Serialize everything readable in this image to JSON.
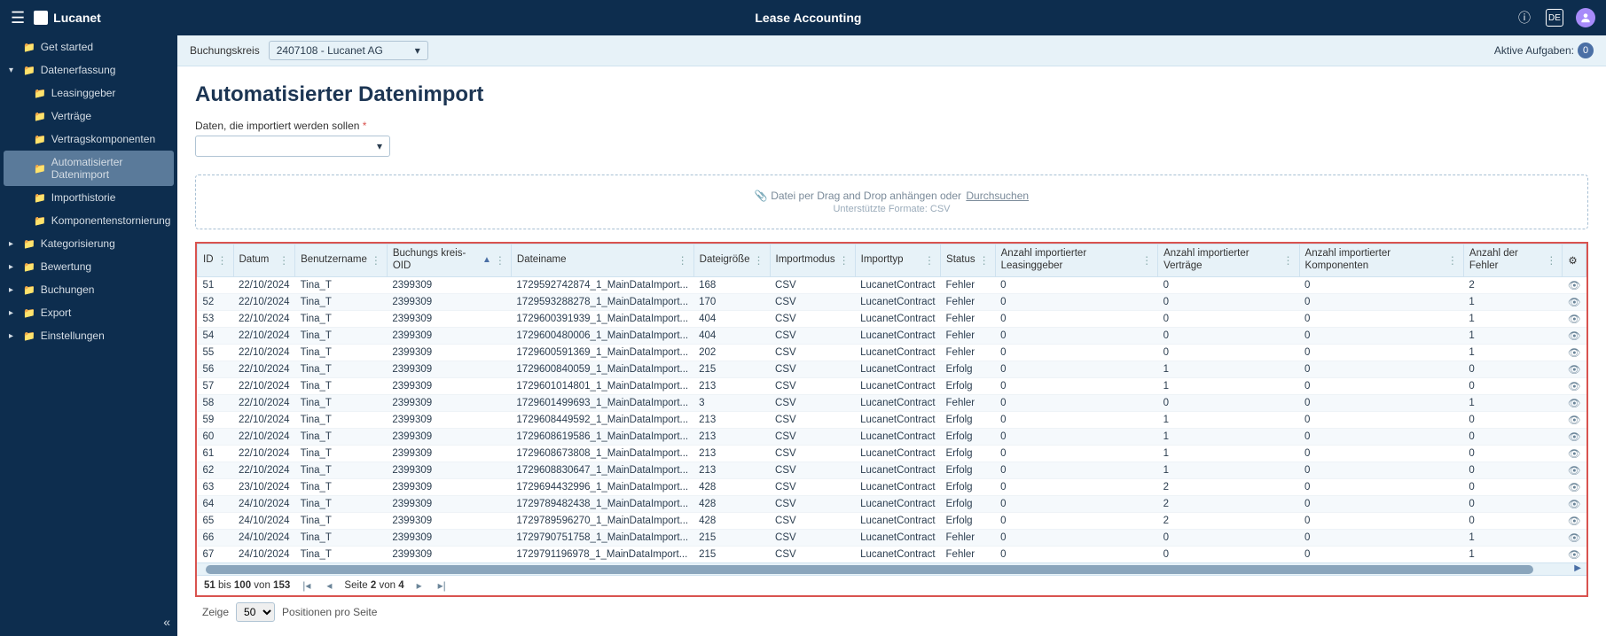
{
  "header": {
    "brand": "Lucanet",
    "title": "Lease Accounting",
    "lang": "DE"
  },
  "sidebar": {
    "items": [
      {
        "label": "Get started",
        "expandable": false,
        "level": 0
      },
      {
        "label": "Datenerfassung",
        "expandable": true,
        "open": true,
        "level": 0
      },
      {
        "label": "Leasinggeber",
        "level": 1
      },
      {
        "label": "Verträge",
        "level": 1
      },
      {
        "label": "Vertragskomponenten",
        "level": 1
      },
      {
        "label": "Automatisierter Datenimport",
        "level": 1,
        "active": true
      },
      {
        "label": "Importhistorie",
        "level": 1
      },
      {
        "label": "Komponentenstornierung",
        "level": 1
      },
      {
        "label": "Kategorisierung",
        "expandable": true,
        "level": 0
      },
      {
        "label": "Bewertung",
        "expandable": true,
        "level": 0
      },
      {
        "label": "Buchungen",
        "expandable": true,
        "level": 0
      },
      {
        "label": "Export",
        "expandable": true,
        "level": 0
      },
      {
        "label": "Einstellungen",
        "expandable": true,
        "level": 0
      }
    ]
  },
  "context": {
    "label": "Buchungskreis",
    "value": "2407108 - Lucanet AG",
    "active_tasks_label": "Aktive Aufgaben:",
    "active_tasks_count": "0"
  },
  "page": {
    "title": "Automatisierter Datenimport",
    "field_label": "Daten, die importiert werden sollen",
    "required_marker": "*"
  },
  "dropzone": {
    "text": "Datei per Drag and Drop anhängen oder",
    "browse": "Durchsuchen",
    "formats_label": "Unterstützte Formate: CSV"
  },
  "table": {
    "columns": [
      "ID",
      "Datum",
      "Benutzername",
      "Buchungs kreis-OID",
      "Dateiname",
      "Dateigröße",
      "Importmodus",
      "Importtyp",
      "Status",
      "Anzahl importierter Leasinggeber",
      "Anzahl importierter Verträge",
      "Anzahl importierter Komponenten",
      "Anzahl der Fehler"
    ],
    "rows": [
      {
        "id": "51",
        "date": "22/10/2024",
        "user": "Tina_T",
        "oid": "2399309",
        "file": "1729592742874_1_MainDataImport...",
        "size": "168",
        "mode": "CSV",
        "type": "LucanetContract",
        "status": "Fehler",
        "lg": "0",
        "vt": "0",
        "kp": "0",
        "err": "2"
      },
      {
        "id": "52",
        "date": "22/10/2024",
        "user": "Tina_T",
        "oid": "2399309",
        "file": "1729593288278_1_MainDataImport...",
        "size": "170",
        "mode": "CSV",
        "type": "LucanetContract",
        "status": "Fehler",
        "lg": "0",
        "vt": "0",
        "kp": "0",
        "err": "1"
      },
      {
        "id": "53",
        "date": "22/10/2024",
        "user": "Tina_T",
        "oid": "2399309",
        "file": "1729600391939_1_MainDataImport...",
        "size": "404",
        "mode": "CSV",
        "type": "LucanetContract",
        "status": "Fehler",
        "lg": "0",
        "vt": "0",
        "kp": "0",
        "err": "1"
      },
      {
        "id": "54",
        "date": "22/10/2024",
        "user": "Tina_T",
        "oid": "2399309",
        "file": "1729600480006_1_MainDataImport...",
        "size": "404",
        "mode": "CSV",
        "type": "LucanetContract",
        "status": "Fehler",
        "lg": "0",
        "vt": "0",
        "kp": "0",
        "err": "1"
      },
      {
        "id": "55",
        "date": "22/10/2024",
        "user": "Tina_T",
        "oid": "2399309",
        "file": "1729600591369_1_MainDataImport...",
        "size": "202",
        "mode": "CSV",
        "type": "LucanetContract",
        "status": "Fehler",
        "lg": "0",
        "vt": "0",
        "kp": "0",
        "err": "1"
      },
      {
        "id": "56",
        "date": "22/10/2024",
        "user": "Tina_T",
        "oid": "2399309",
        "file": "1729600840059_1_MainDataImport...",
        "size": "215",
        "mode": "CSV",
        "type": "LucanetContract",
        "status": "Erfolg",
        "lg": "0",
        "vt": "1",
        "kp": "0",
        "err": "0"
      },
      {
        "id": "57",
        "date": "22/10/2024",
        "user": "Tina_T",
        "oid": "2399309",
        "file": "1729601014801_1_MainDataImport...",
        "size": "213",
        "mode": "CSV",
        "type": "LucanetContract",
        "status": "Erfolg",
        "lg": "0",
        "vt": "1",
        "kp": "0",
        "err": "0"
      },
      {
        "id": "58",
        "date": "22/10/2024",
        "user": "Tina_T",
        "oid": "2399309",
        "file": "1729601499693_1_MainDataImport...",
        "size": "3",
        "mode": "CSV",
        "type": "LucanetContract",
        "status": "Fehler",
        "lg": "0",
        "vt": "0",
        "kp": "0",
        "err": "1"
      },
      {
        "id": "59",
        "date": "22/10/2024",
        "user": "Tina_T",
        "oid": "2399309",
        "file": "1729608449592_1_MainDataImport...",
        "size": "213",
        "mode": "CSV",
        "type": "LucanetContract",
        "status": "Erfolg",
        "lg": "0",
        "vt": "1",
        "kp": "0",
        "err": "0"
      },
      {
        "id": "60",
        "date": "22/10/2024",
        "user": "Tina_T",
        "oid": "2399309",
        "file": "1729608619586_1_MainDataImport...",
        "size": "213",
        "mode": "CSV",
        "type": "LucanetContract",
        "status": "Erfolg",
        "lg": "0",
        "vt": "1",
        "kp": "0",
        "err": "0"
      },
      {
        "id": "61",
        "date": "22/10/2024",
        "user": "Tina_T",
        "oid": "2399309",
        "file": "1729608673808_1_MainDataImport...",
        "size": "213",
        "mode": "CSV",
        "type": "LucanetContract",
        "status": "Erfolg",
        "lg": "0",
        "vt": "1",
        "kp": "0",
        "err": "0"
      },
      {
        "id": "62",
        "date": "22/10/2024",
        "user": "Tina_T",
        "oid": "2399309",
        "file": "1729608830647_1_MainDataImport...",
        "size": "213",
        "mode": "CSV",
        "type": "LucanetContract",
        "status": "Erfolg",
        "lg": "0",
        "vt": "1",
        "kp": "0",
        "err": "0"
      },
      {
        "id": "63",
        "date": "23/10/2024",
        "user": "Tina_T",
        "oid": "2399309",
        "file": "1729694432996_1_MainDataImport...",
        "size": "428",
        "mode": "CSV",
        "type": "LucanetContract",
        "status": "Erfolg",
        "lg": "0",
        "vt": "2",
        "kp": "0",
        "err": "0"
      },
      {
        "id": "64",
        "date": "24/10/2024",
        "user": "Tina_T",
        "oid": "2399309",
        "file": "1729789482438_1_MainDataImport...",
        "size": "428",
        "mode": "CSV",
        "type": "LucanetContract",
        "status": "Erfolg",
        "lg": "0",
        "vt": "2",
        "kp": "0",
        "err": "0"
      },
      {
        "id": "65",
        "date": "24/10/2024",
        "user": "Tina_T",
        "oid": "2399309",
        "file": "1729789596270_1_MainDataImport...",
        "size": "428",
        "mode": "CSV",
        "type": "LucanetContract",
        "status": "Erfolg",
        "lg": "0",
        "vt": "2",
        "kp": "0",
        "err": "0"
      },
      {
        "id": "66",
        "date": "24/10/2024",
        "user": "Tina_T",
        "oid": "2399309",
        "file": "1729790751758_1_MainDataImport...",
        "size": "215",
        "mode": "CSV",
        "type": "LucanetContract",
        "status": "Fehler",
        "lg": "0",
        "vt": "0",
        "kp": "0",
        "err": "1"
      },
      {
        "id": "67",
        "date": "24/10/2024",
        "user": "Tina_T",
        "oid": "2399309",
        "file": "1729791196978_1_MainDataImport...",
        "size": "215",
        "mode": "CSV",
        "type": "LucanetContract",
        "status": "Fehler",
        "lg": "0",
        "vt": "0",
        "kp": "0",
        "err": "1"
      }
    ]
  },
  "pager": {
    "range_from": "51",
    "range_to": "100",
    "bis": "bis",
    "von": "von",
    "total": "153",
    "page_label_pre": "Seite",
    "page_current": "2",
    "page_label_mid": "von",
    "page_total": "4"
  },
  "footer": {
    "show_label": "Zeige",
    "page_size": "50",
    "per_page_label": "Positionen pro Seite"
  }
}
